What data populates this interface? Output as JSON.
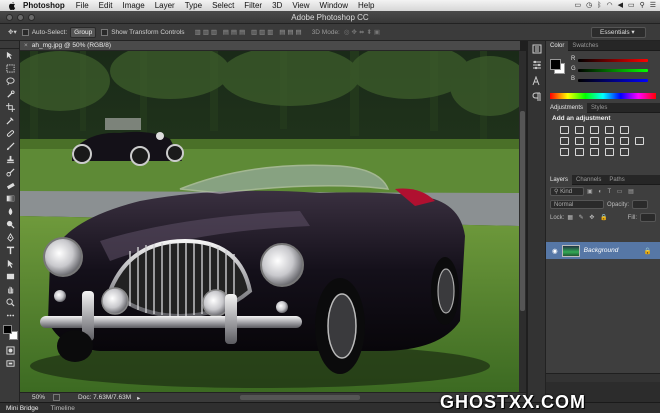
{
  "menubar": {
    "app": "Photoshop",
    "items": [
      "File",
      "Edit",
      "Image",
      "Layer",
      "Type",
      "Select",
      "Filter",
      "3D",
      "View",
      "Window",
      "Help"
    ]
  },
  "window": {
    "title": "Adobe Photoshop CC"
  },
  "options": {
    "auto_select_label": "Auto-Select:",
    "auto_select_value": "Group",
    "transform_label": "Show Transform Controls",
    "mode_label": "3D Mode:",
    "workspace": "Essentials"
  },
  "document": {
    "tab_label": "ah_mg.jpg @ 50% (RGB/8)",
    "zoom": "50%",
    "doc_info": "Doc: 7.63M/7.63M"
  },
  "panels": {
    "color_tabs": [
      "Color",
      "Swatches"
    ],
    "adjust_tabs": [
      "Adjustments",
      "Styles"
    ],
    "adjust_title": "Add an adjustment",
    "layer_tabs": [
      "Layers",
      "Channels",
      "Paths"
    ],
    "kind_label": "Kind",
    "blend_mode": "Normal",
    "opacity_label": "Opacity:",
    "lock_label": "Lock:",
    "fill_label": "Fill:",
    "layer_name": "Background"
  },
  "colors": {
    "accent": "#5677a6",
    "panel": "#3e3e3e"
  },
  "bottom_tabs": [
    "Mini Bridge",
    "Timeline"
  ],
  "watermark": "GHOSTXX.COM"
}
